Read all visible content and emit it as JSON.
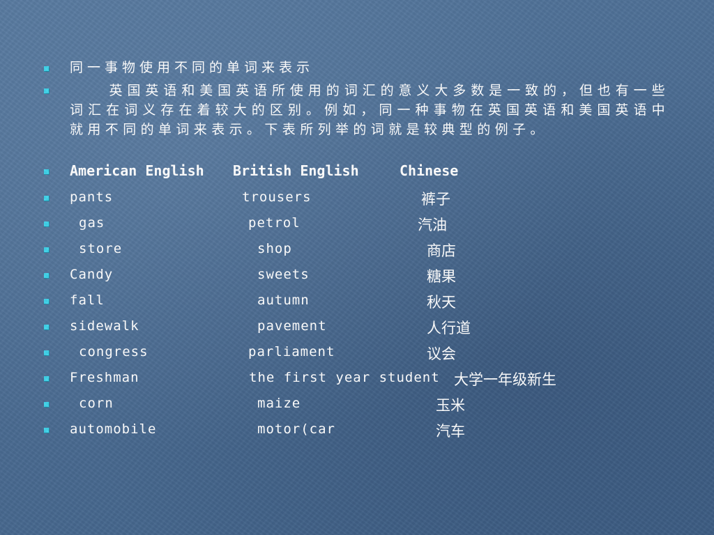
{
  "bullets": [
    "同一事物使用不同的单词来表示",
    "英国英语和美国英语所使用的词汇的意义大多数是一致的，但也有一些词汇在词义存在着较大的区别。例如，同一种事物在英国英语和美国英语中就用不同的单词来表示。下表所列举的词就是较典型的例子。"
  ],
  "table": {
    "header": {
      "american": "American English",
      "british": "British English",
      "chinese": "Chinese"
    },
    "rows": [
      {
        "american": "pants",
        "british": "trousers",
        "chinese": "裤子"
      },
      {
        "american": "gas",
        "british": "petrol",
        "chinese": "汽油"
      },
      {
        "american": "store",
        "british": "shop",
        "chinese": "商店"
      },
      {
        "american": "Candy",
        "british": "sweets",
        "chinese": "糖果"
      },
      {
        "american": "fall",
        "british": "autumn",
        "chinese": "秋天"
      },
      {
        "american": "sidewalk",
        "british": "pavement",
        "chinese": "人行道"
      },
      {
        "american": "congress",
        "british": "parliament",
        "chinese": "议会"
      },
      {
        "american": "Freshman",
        "british": "the first year student",
        "chinese": "大学一年级新生"
      },
      {
        "american": "corn",
        "british": "maize",
        "chinese": "玉米"
      },
      {
        "american": "automobile",
        "british": "motor(car",
        "chinese": "汽车"
      }
    ]
  },
  "colors": {
    "bullet": "#3fd3ea",
    "text": "#ffffff",
    "background": "#4a6b91"
  }
}
